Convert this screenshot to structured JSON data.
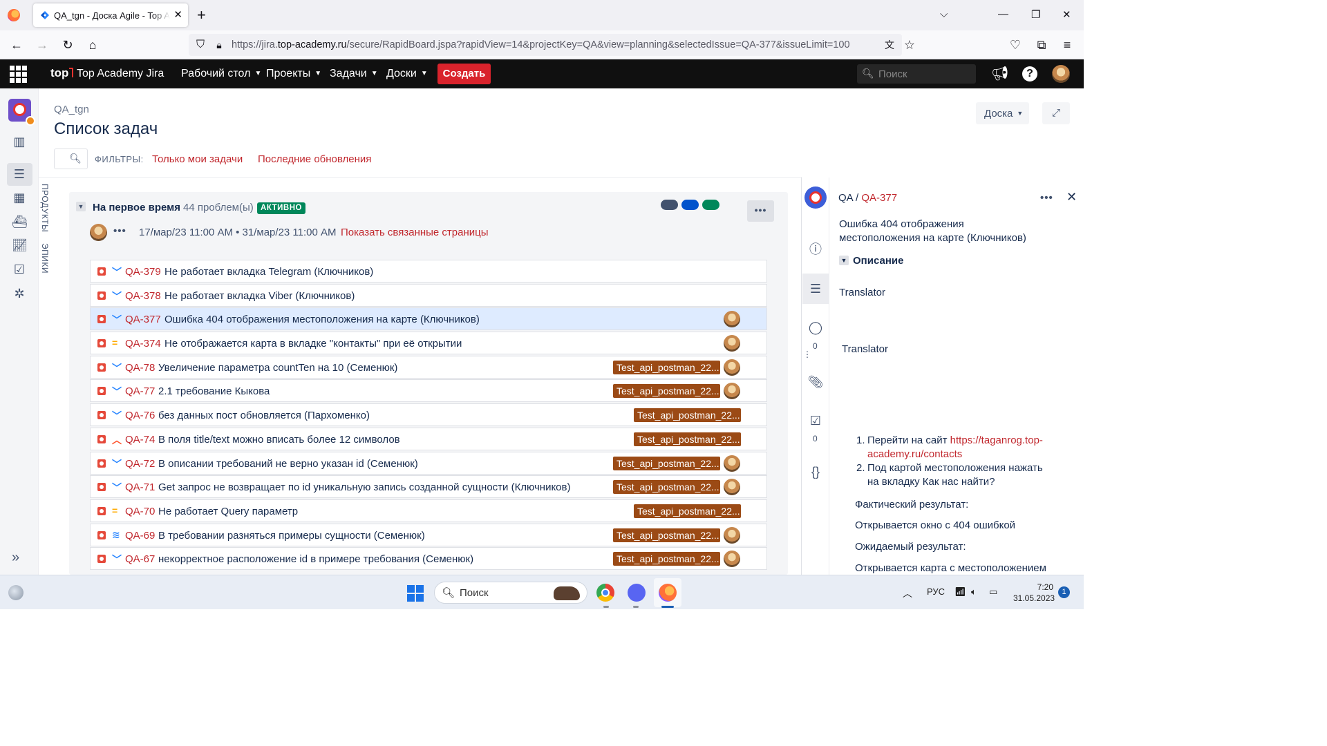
{
  "browser": {
    "tab_title": "QA_tgn - Доска Agile - Top Academy Jira",
    "url_prefix": "https://jira.",
    "url_domain": "top-academy.ru",
    "url_rest": "/secure/RapidBoard.jspa?rapidView=14&projectKey=QA&view=planning&selectedIssue=QA-377&issueLimit=100"
  },
  "jira_header": {
    "logo_mark": "top",
    "logo_text": "Top Academy Jira",
    "menu": [
      "Рабочий стол",
      "Проекты",
      "Задачи",
      "Доски"
    ],
    "create_label": "Создать",
    "search_placeholder": "Поиск"
  },
  "page": {
    "breadcrumb": "QA_tgn",
    "title": "Список задач",
    "board_button": "Доска",
    "filters_label": "ФИЛЬТРЫ:",
    "filter_mine": "Только мои задачи",
    "filter_recent": "Последние обновления",
    "vertical_labels": [
      "ПРОДУКТЫ",
      "ЭПИКИ"
    ]
  },
  "sprint": {
    "name": "На первое время",
    "count": "44 проблем(ы)",
    "status": "АКТИВНО",
    "dates": "17/мар/23 11:00 AM • 31/мар/23 11:00 AM",
    "linked_pages": "Показать связанные страницы",
    "status_colors": [
      "#42526e",
      "#0052cc",
      "#00875a"
    ]
  },
  "issues": [
    {
      "key": "QA-379",
      "summary": "Не работает вкладка Telegram (Ключников)",
      "priority": "low",
      "epic": "",
      "avatar": false,
      "selected": false
    },
    {
      "key": "QA-378",
      "summary": "Не работает вкладка Viber (Ключников)",
      "priority": "low",
      "epic": "",
      "avatar": false,
      "selected": false
    },
    {
      "key": "QA-377",
      "summary": "Ошибка 404 отображения местоположения на карте (Ключников)",
      "priority": "low",
      "epic": "",
      "avatar": true,
      "selected": true
    },
    {
      "key": "QA-374",
      "summary": "Не отображается карта в вкладке \"контакты\" при её открытии",
      "priority": "med",
      "epic": "",
      "avatar": true,
      "selected": false
    },
    {
      "key": "QA-78",
      "summary": "Увеличение параметра countTen на 10 (Семенюк)",
      "priority": "low",
      "epic": "Test_api_postman_22...",
      "avatar": true,
      "selected": false
    },
    {
      "key": "QA-77",
      "summary": "2.1 требование Кыкова",
      "priority": "low",
      "epic": "Test_api_postman_22...",
      "avatar": true,
      "selected": false
    },
    {
      "key": "QA-76",
      "summary": "без данных пост обновляется (Пархоменко)",
      "priority": "low",
      "epic": "Test_api_postman_22...",
      "avatar": false,
      "selected": false
    },
    {
      "key": "QA-74",
      "summary": "В поля title/text можно вписать более 12 символов",
      "priority": "high",
      "epic": "Test_api_postman_22...",
      "avatar": false,
      "selected": false
    },
    {
      "key": "QA-72",
      "summary": "В описании требований не верно указан id (Семенюк)",
      "priority": "low",
      "epic": "Test_api_postman_22...",
      "avatar": true,
      "selected": false
    },
    {
      "key": "QA-71",
      "summary": "Get запрос не возвращает по id уникальную запись созданной сущности (Ключников)",
      "priority": "low",
      "epic": "Test_api_postman_22...",
      "avatar": true,
      "selected": false
    },
    {
      "key": "QA-70",
      "summary": "Не работает Query параметр",
      "priority": "med",
      "epic": "Test_api_postman_22...",
      "avatar": false,
      "selected": false
    },
    {
      "key": "QA-69",
      "summary": "В требовании разняться примеры сущности (Семенюк)",
      "priority": "lowest",
      "epic": "Test_api_postman_22...",
      "avatar": true,
      "selected": false
    },
    {
      "key": "QA-67",
      "summary": "некорректное расположение id в примере требования (Семенюк)",
      "priority": "low",
      "epic": "Test_api_postman_22...",
      "avatar": true,
      "selected": false
    }
  ],
  "detail": {
    "project": "QA",
    "key": "QA-377",
    "title": "Ошибка 404 отображения местоположения на карте (Ключников)",
    "section": "Описание",
    "translator1": "Translator",
    "translator2": "Translator",
    "comments_count": "0",
    "checklist_count": "0",
    "step1_text": "Перейти на сайт ",
    "step1_link": "https://taganrog.top-academy.ru/contacts",
    "step2_text": "Под картой местоположения нажать на вкладку Как нас найти?",
    "actual_label": "Фактический результат:",
    "actual_value": "Открывается окно с 404 ошибкой",
    "expected_label": "Ожидаемый результат:",
    "expected_value": "Открывается карта с местоположением"
  },
  "taskbar": {
    "search_placeholder": "Поиск",
    "lang": "РУС",
    "time": "7:20",
    "date": "31.05.2023",
    "notifications": "1"
  }
}
